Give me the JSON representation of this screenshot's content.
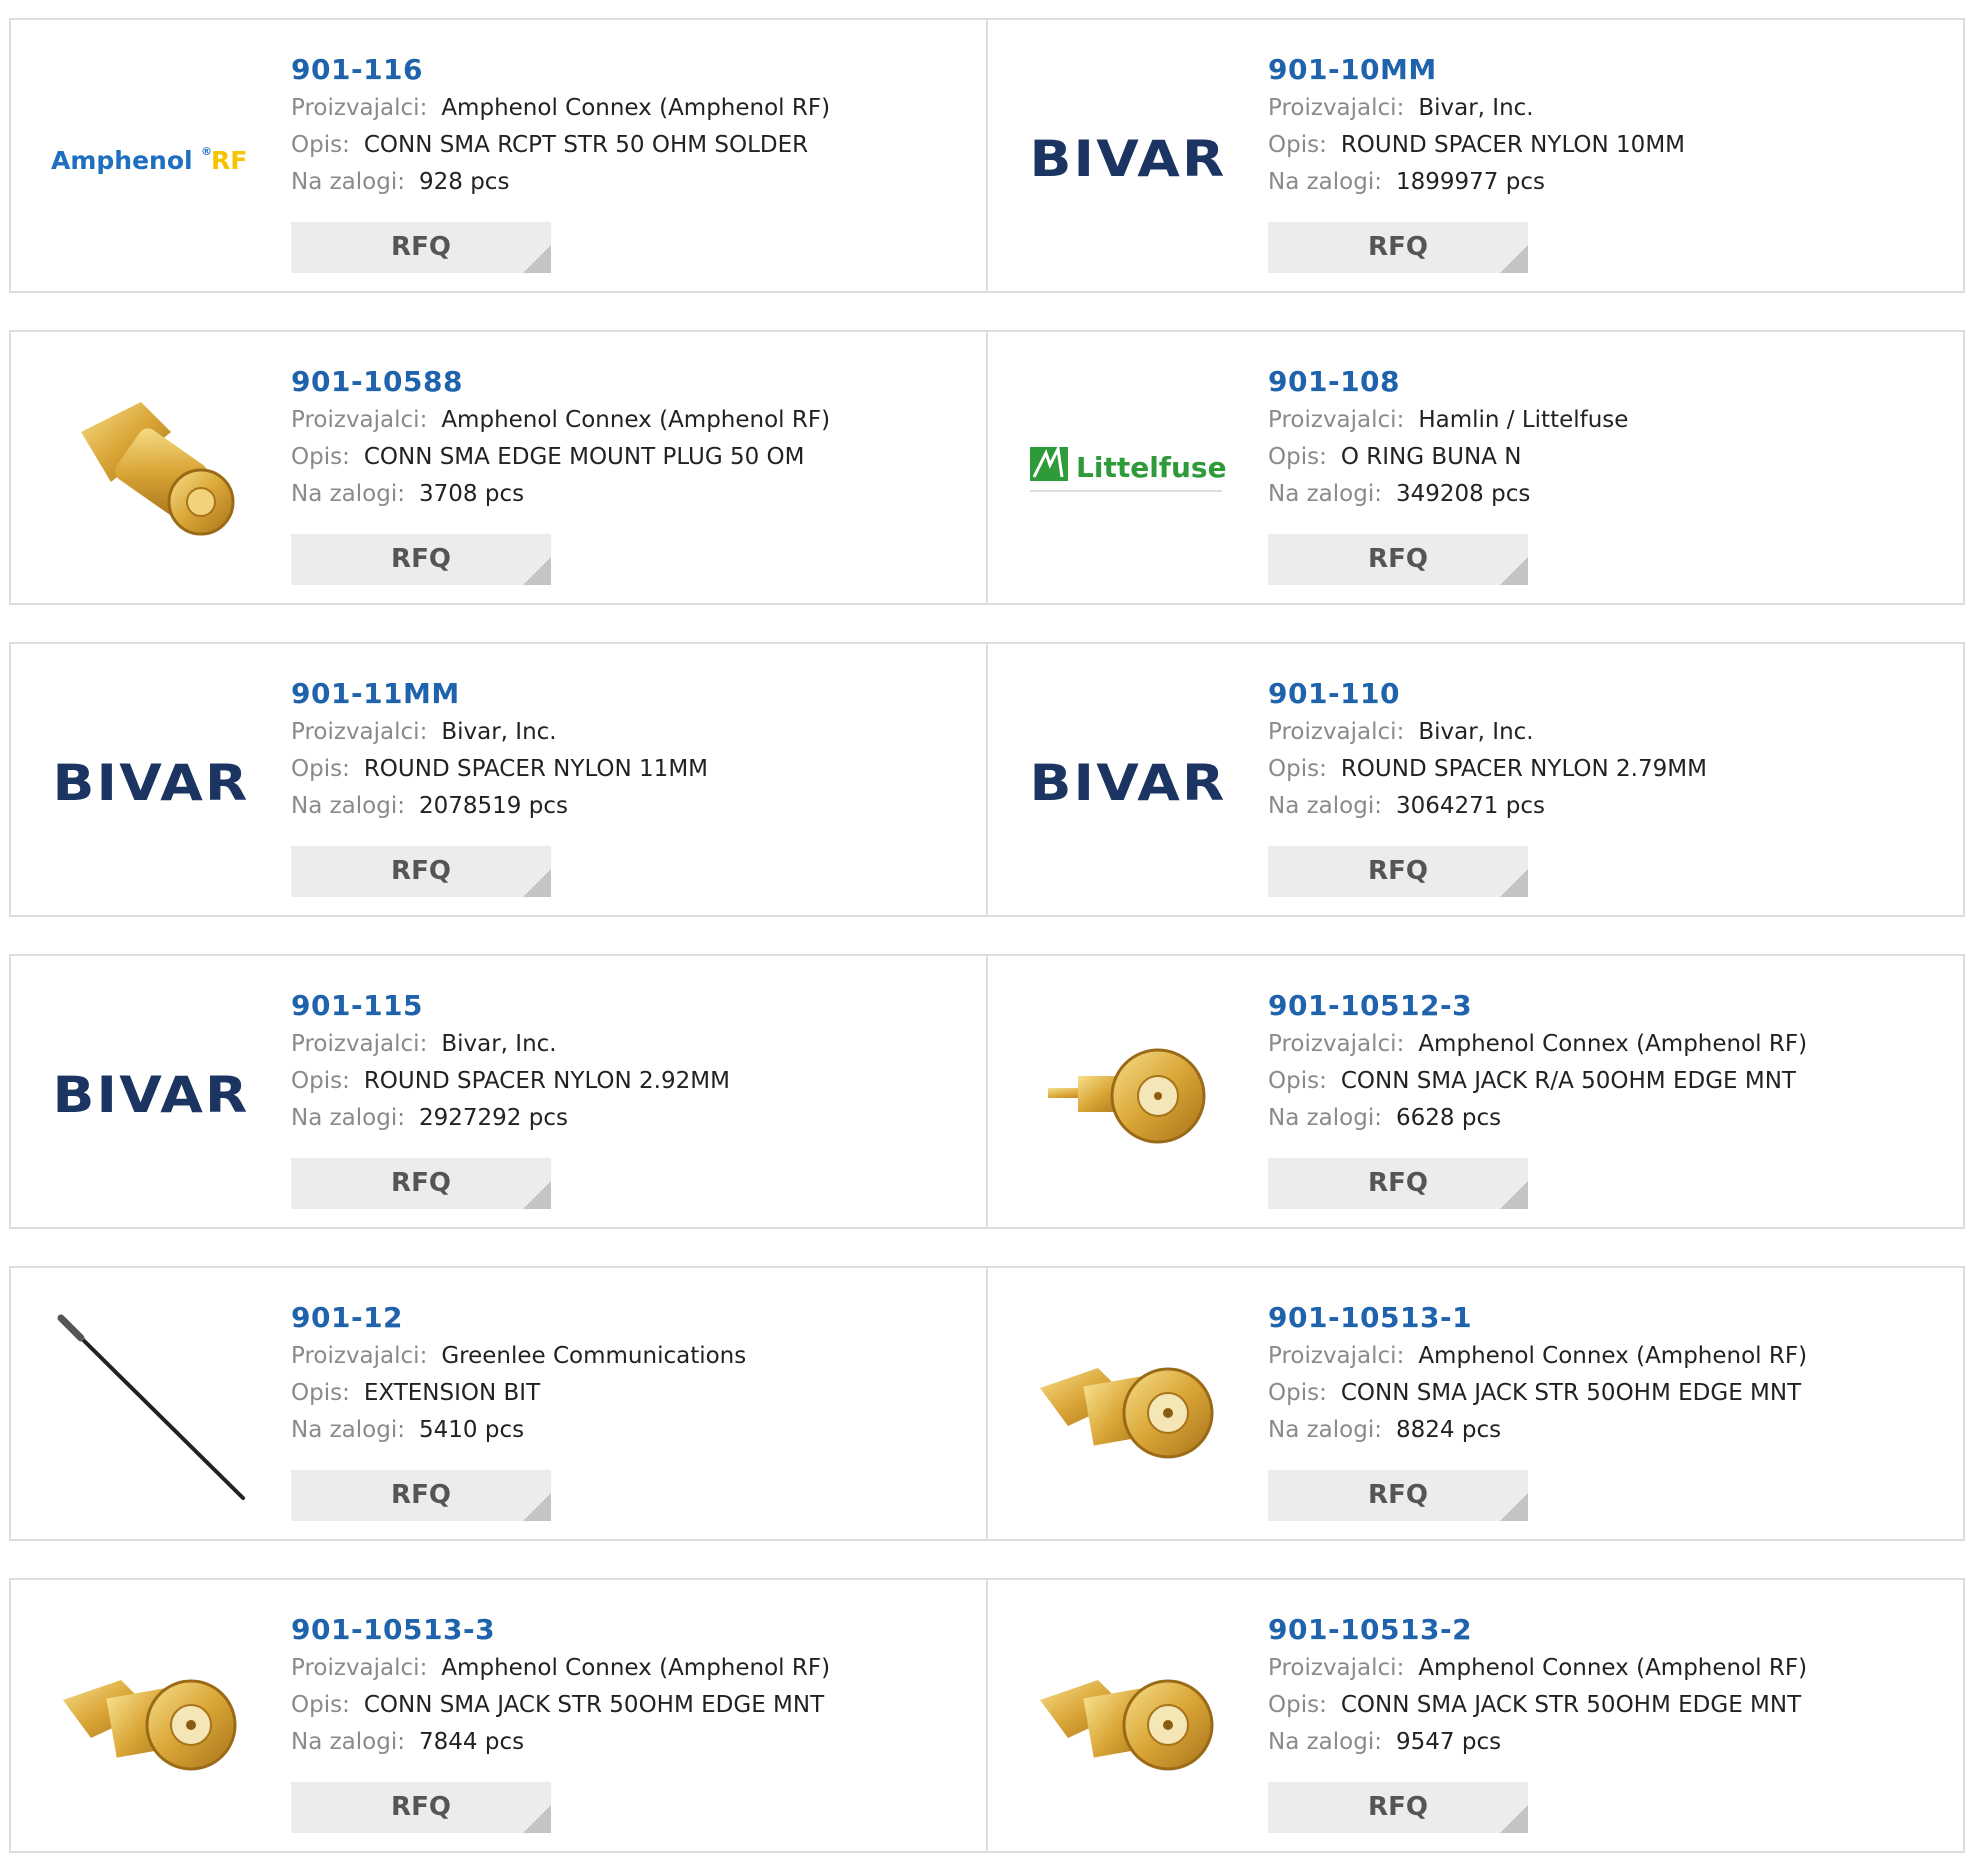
{
  "labels": {
    "manufacturer": "Proizvajalci:",
    "description": "Opis:",
    "stock": "Na zalogi:",
    "rfq": "RFQ",
    "unit": "pcs"
  },
  "colors": {
    "link": "#1f63ad",
    "bivar": "#1b3461",
    "amphenol_blue": "#1e6fbf",
    "amphenol_yellow": "#f5c400",
    "littelfuse_green": "#2e9a3a"
  },
  "products": [
    {
      "part": "901-116",
      "manufacturer": "Amphenol Connex (Amphenol RF)",
      "description": "CONN SMA RCPT STR 50 OHM SOLDER",
      "stock": "928",
      "image": "amphenol-rf-logo"
    },
    {
      "part": "901-10MM",
      "manufacturer": "Bivar, Inc.",
      "description": "ROUND SPACER NYLON 10MM",
      "stock": "1899977",
      "image": "bivar-logo"
    },
    {
      "part": "901-10588",
      "manufacturer": "Amphenol Connex (Amphenol RF)",
      "description": "CONN SMA EDGE MOUNT PLUG 50 OM",
      "stock": "3708",
      "image": "sma-plug-photo"
    },
    {
      "part": "901-108",
      "manufacturer": "Hamlin / Littelfuse",
      "description": "O RING BUNA N",
      "stock": "349208",
      "image": "littelfuse-logo"
    },
    {
      "part": "901-11MM",
      "manufacturer": "Bivar, Inc.",
      "description": "ROUND SPACER NYLON 11MM",
      "stock": "2078519",
      "image": "bivar-logo"
    },
    {
      "part": "901-110",
      "manufacturer": "Bivar, Inc.",
      "description": "ROUND SPACER NYLON 2.79MM",
      "stock": "3064271",
      "image": "bivar-logo"
    },
    {
      "part": "901-115",
      "manufacturer": "Bivar, Inc.",
      "description": "ROUND SPACER NYLON 2.92MM",
      "stock": "2927292",
      "image": "bivar-logo"
    },
    {
      "part": "901-10512-3",
      "manufacturer": "Amphenol Connex (Amphenol RF)",
      "description": "CONN SMA JACK R/A 50OHM EDGE MNT",
      "stock": "6628",
      "image": "sma-jack-ra-photo"
    },
    {
      "part": "901-12",
      "manufacturer": "Greenlee Communications",
      "description": "EXTENSION BIT",
      "stock": "5410",
      "image": "extension-bit-photo"
    },
    {
      "part": "901-10513-1",
      "manufacturer": "Amphenol Connex (Amphenol RF)",
      "description": "CONN SMA JACK STR 50OHM EDGE MNT",
      "stock": "8824",
      "image": "sma-jack-photo"
    },
    {
      "part": "901-10513-3",
      "manufacturer": "Amphenol Connex (Amphenol RF)",
      "description": "CONN SMA JACK STR 50OHM EDGE MNT",
      "stock": "7844",
      "image": "sma-jack-photo"
    },
    {
      "part": "901-10513-2",
      "manufacturer": "Amphenol Connex (Amphenol RF)",
      "description": "CONN SMA JACK STR 50OHM EDGE MNT",
      "stock": "9547",
      "image": "sma-jack-photo"
    }
  ]
}
